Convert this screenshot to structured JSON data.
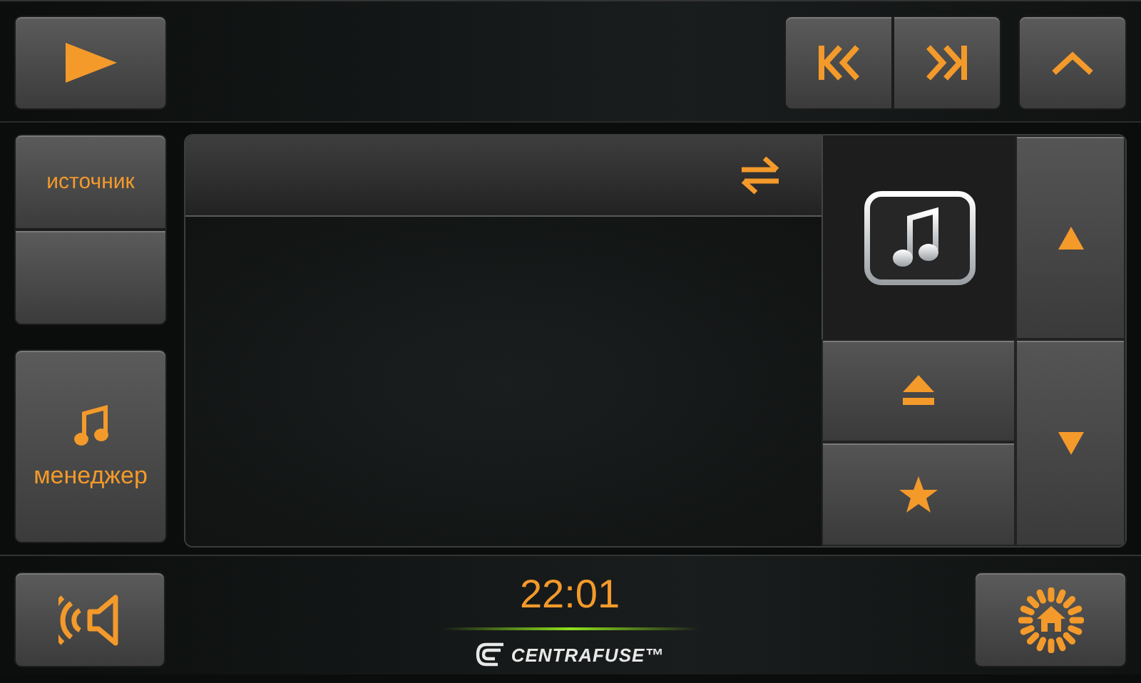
{
  "sidebar": {
    "source_button": {
      "label": "источник"
    },
    "manager_button": {
      "label": "менеджер"
    }
  },
  "status_bar": {
    "clock": "22:01",
    "logo": "CENTRAFUSE™"
  }
}
